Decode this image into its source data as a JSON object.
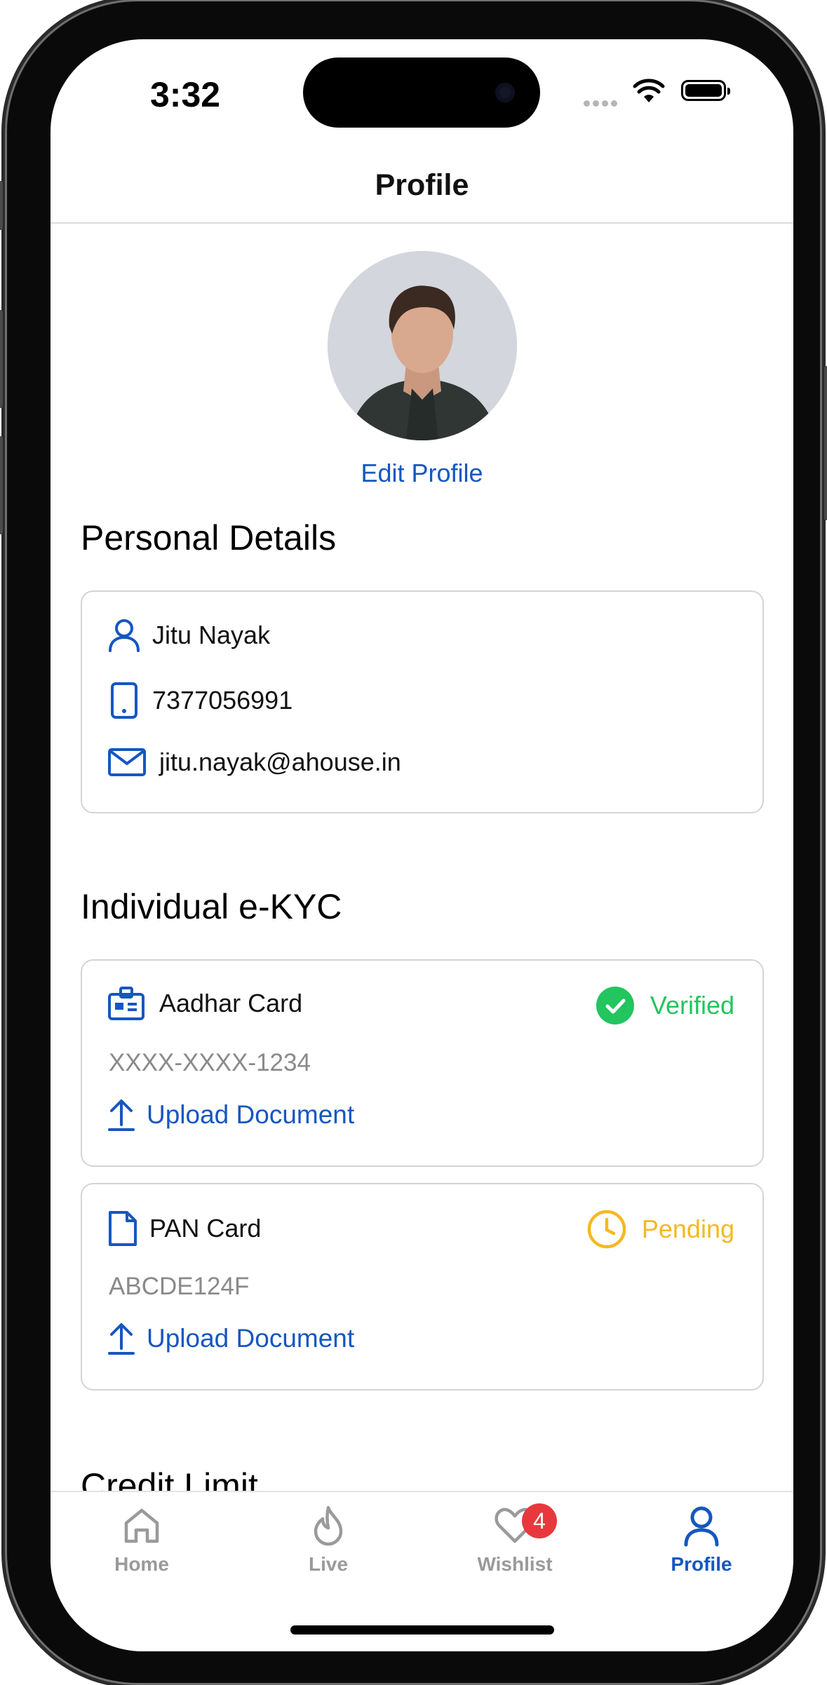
{
  "status_bar": {
    "time": "3:32"
  },
  "header": {
    "title": "Profile"
  },
  "profile": {
    "edit_label": "Edit Profile"
  },
  "personal": {
    "title": "Personal Details",
    "name": "Jitu Nayak",
    "phone": "7377056991",
    "email": "jitu.nayak@ahouse.in"
  },
  "kyc": {
    "title": "Individual e-KYC",
    "documents": [
      {
        "name": "Aadhar Card",
        "status": "Verified",
        "status_color": "#22c55e",
        "number": "XXXX-XXXX-1234",
        "action": "Upload Document"
      },
      {
        "name": "PAN Card",
        "status": "Pending",
        "status_color": "#f5b820",
        "number": "ABCDE124F",
        "action": "Upload Document"
      }
    ]
  },
  "credit": {
    "title": "Credit Limit"
  },
  "tabs": [
    {
      "label": "Home",
      "icon": "home-icon"
    },
    {
      "label": "Live",
      "icon": "flame-icon"
    },
    {
      "label": "Wishlist",
      "icon": "heart-icon",
      "badge": "4"
    },
    {
      "label": "Profile",
      "icon": "user-icon",
      "active": true
    }
  ],
  "colors": {
    "accent": "#1557c0",
    "verified": "#22c55e",
    "pending": "#f5b820",
    "badge": "#e8383d"
  }
}
